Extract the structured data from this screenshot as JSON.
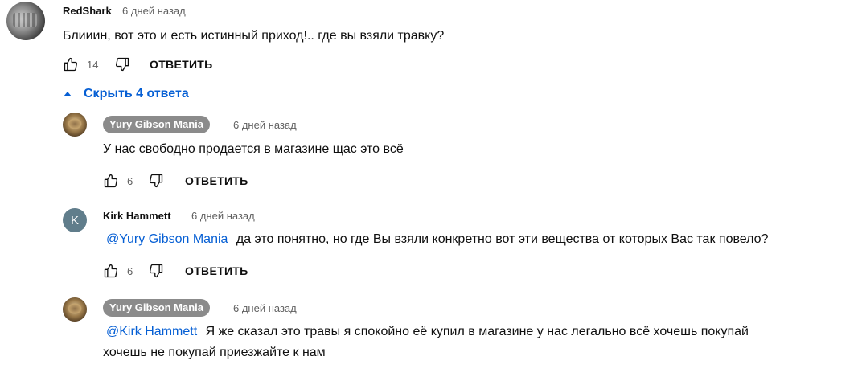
{
  "comments": [
    {
      "author": "RedShark",
      "time": "6 дней назад",
      "text": "Блииин, вот это и есть истинный приход!.. где вы взяли травку?",
      "likes": "14",
      "reply_label": "ОТВЕТИТЬ"
    }
  ],
  "replies_toggle": {
    "label": "Скрыть 4 ответа"
  },
  "replies": [
    {
      "author": "Yury Gibson Mania",
      "time": "6 дней назад",
      "text": "У нас свободно продается в магазине щас это всё",
      "likes": "6",
      "reply_label": "ОТВЕТИТЬ"
    },
    {
      "author": "Kirk Hammett",
      "avatar_letter": "K",
      "time": "6 дней назад",
      "mention": "@Yury Gibson Mania",
      "text": "да это понятно, но где Вы взяли конкретно вот эти вещества от которых Вас так повело?",
      "likes": "6",
      "reply_label": "ОТВЕТИТЬ"
    },
    {
      "author": "Yury Gibson Mania",
      "time": "6 дней назад",
      "mention": "@Kirk Hammett",
      "text_line1": "Я же сказал это травы я спокойно её купил в магазине у нас легально всё хочешь покупай",
      "text_line2": "хочешь не покупай приезжайте к нам"
    }
  ],
  "icons": {
    "like": "thumbs-up-icon",
    "dislike": "thumbs-down-icon",
    "toggle": "caret-up-icon"
  },
  "colors": {
    "link": "#065fd4",
    "secondary_text": "#606060",
    "badge_bg": "#8b8b8b",
    "kirk_avatar_bg": "#607d8b"
  }
}
